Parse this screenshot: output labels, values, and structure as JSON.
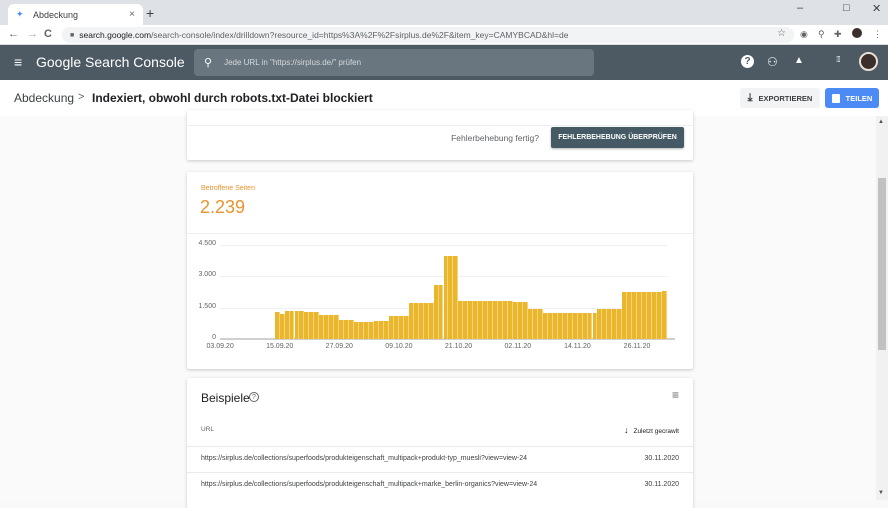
{
  "browser": {
    "tab_title": "Abdeckung",
    "tab_close": "×",
    "new_tab": "+",
    "window_controls": {
      "minimize": "–",
      "maximize": "□",
      "close": "✕"
    },
    "url_host": "search.google.com",
    "url_path": "/search-console/index/drilldown?resource_id=https%3A%2F%2Fsirplus.de%2F&item_key=CAMYBCAD&hl=de",
    "icons": {
      "back": "←",
      "forward": "→",
      "reload": "C",
      "lock": "🔒",
      "star": "☆",
      "menu": "⋮"
    }
  },
  "header": {
    "menu_icon": "≡",
    "logo": "Google Search Console",
    "search_placeholder": "Jede URL in \"https://sirplus.de/\" prüfen",
    "search_icon": "⚲",
    "help_icon": "?",
    "settings_icon": "⚇",
    "bell_icon": "🔔",
    "apps_icon": "⋮⋮⋮"
  },
  "breadcrumb": {
    "parent": "Abdeckung",
    "separator": ">",
    "current": "Indexiert, obwohl durch robots.txt-Datei blockiert"
  },
  "actions": {
    "export_label": "EXPORTIEREN",
    "export_icon": "⤓",
    "share_label": "TEILEN",
    "share_icon": "🔒"
  },
  "fix_card": {
    "question": "Fehlerbehebung fertig?",
    "validate_label": "FEHLERBEHEBUNG ÜBERPRÜFEN"
  },
  "metric": {
    "label": "Betroffene Seiten",
    "value": "2.239"
  },
  "colors": {
    "accent": "#e8942c",
    "bar": "#eab72c",
    "header_bg": "#4d5a64",
    "share_button": "#4c8bf5",
    "validate_button": "#455a64"
  },
  "chart_data": {
    "type": "bar",
    "title": "Betroffene Seiten",
    "xlabel": "",
    "ylabel": "",
    "ylim": [
      0,
      4500
    ],
    "yticks": [
      0,
      1500,
      3000,
      4500
    ],
    "ytick_labels": [
      "0",
      "1.500",
      "3.000",
      "4.500"
    ],
    "xtick_labels": [
      "03.09.20",
      "15.09.20",
      "27.09.20",
      "09.10.20",
      "21.10.20",
      "02.11.20",
      "14.11.20",
      "26.11.20"
    ],
    "x_start": "03.09.20",
    "x_end": "30.11.20",
    "grid": true,
    "legend": "none",
    "empty_days_before_data": 11,
    "series": [
      {
        "name": "Betroffene Seiten",
        "start": "14.09.20",
        "values": [
          1300,
          1200,
          1350,
          1350,
          1350,
          1350,
          1280,
          1280,
          1280,
          1130,
          1130,
          1130,
          1130,
          920,
          920,
          920,
          830,
          830,
          830,
          830,
          850,
          850,
          850,
          1080,
          1080,
          1080,
          1080,
          1700,
          1700,
          1700,
          1700,
          1700,
          2600,
          2600,
          3950,
          3950,
          3950,
          1800,
          1800,
          1800,
          1800,
          1800,
          1800,
          1800,
          1800,
          1800,
          1800,
          1800,
          1750,
          1750,
          1750,
          1450,
          1450,
          1450,
          1250,
          1250,
          1250,
          1250,
          1250,
          1250,
          1250,
          1250,
          1250,
          1250,
          1250,
          1450,
          1450,
          1450,
          1450,
          1450,
          2250,
          2250,
          2250,
          2250,
          2250,
          2250,
          2250,
          2250,
          2300
        ]
      }
    ]
  },
  "examples": {
    "title": "Beispiele",
    "help_icon": "?",
    "filter_icon": "☰",
    "col_url": "URL",
    "col_date": "Zuletzt gecrawlt",
    "sort_icon": "↓",
    "rows": [
      {
        "url": "https://sirplus.de/collections/superfoods/produkteigenschaft_multipack+produkt-typ_muesli?view=view-24",
        "date": "30.11.2020"
      },
      {
        "url": "https://sirplus.de/collections/superfoods/produkteigenschaft_multipack+marke_berlin-organics?view=view-24",
        "date": "30.11.2020"
      }
    ]
  }
}
